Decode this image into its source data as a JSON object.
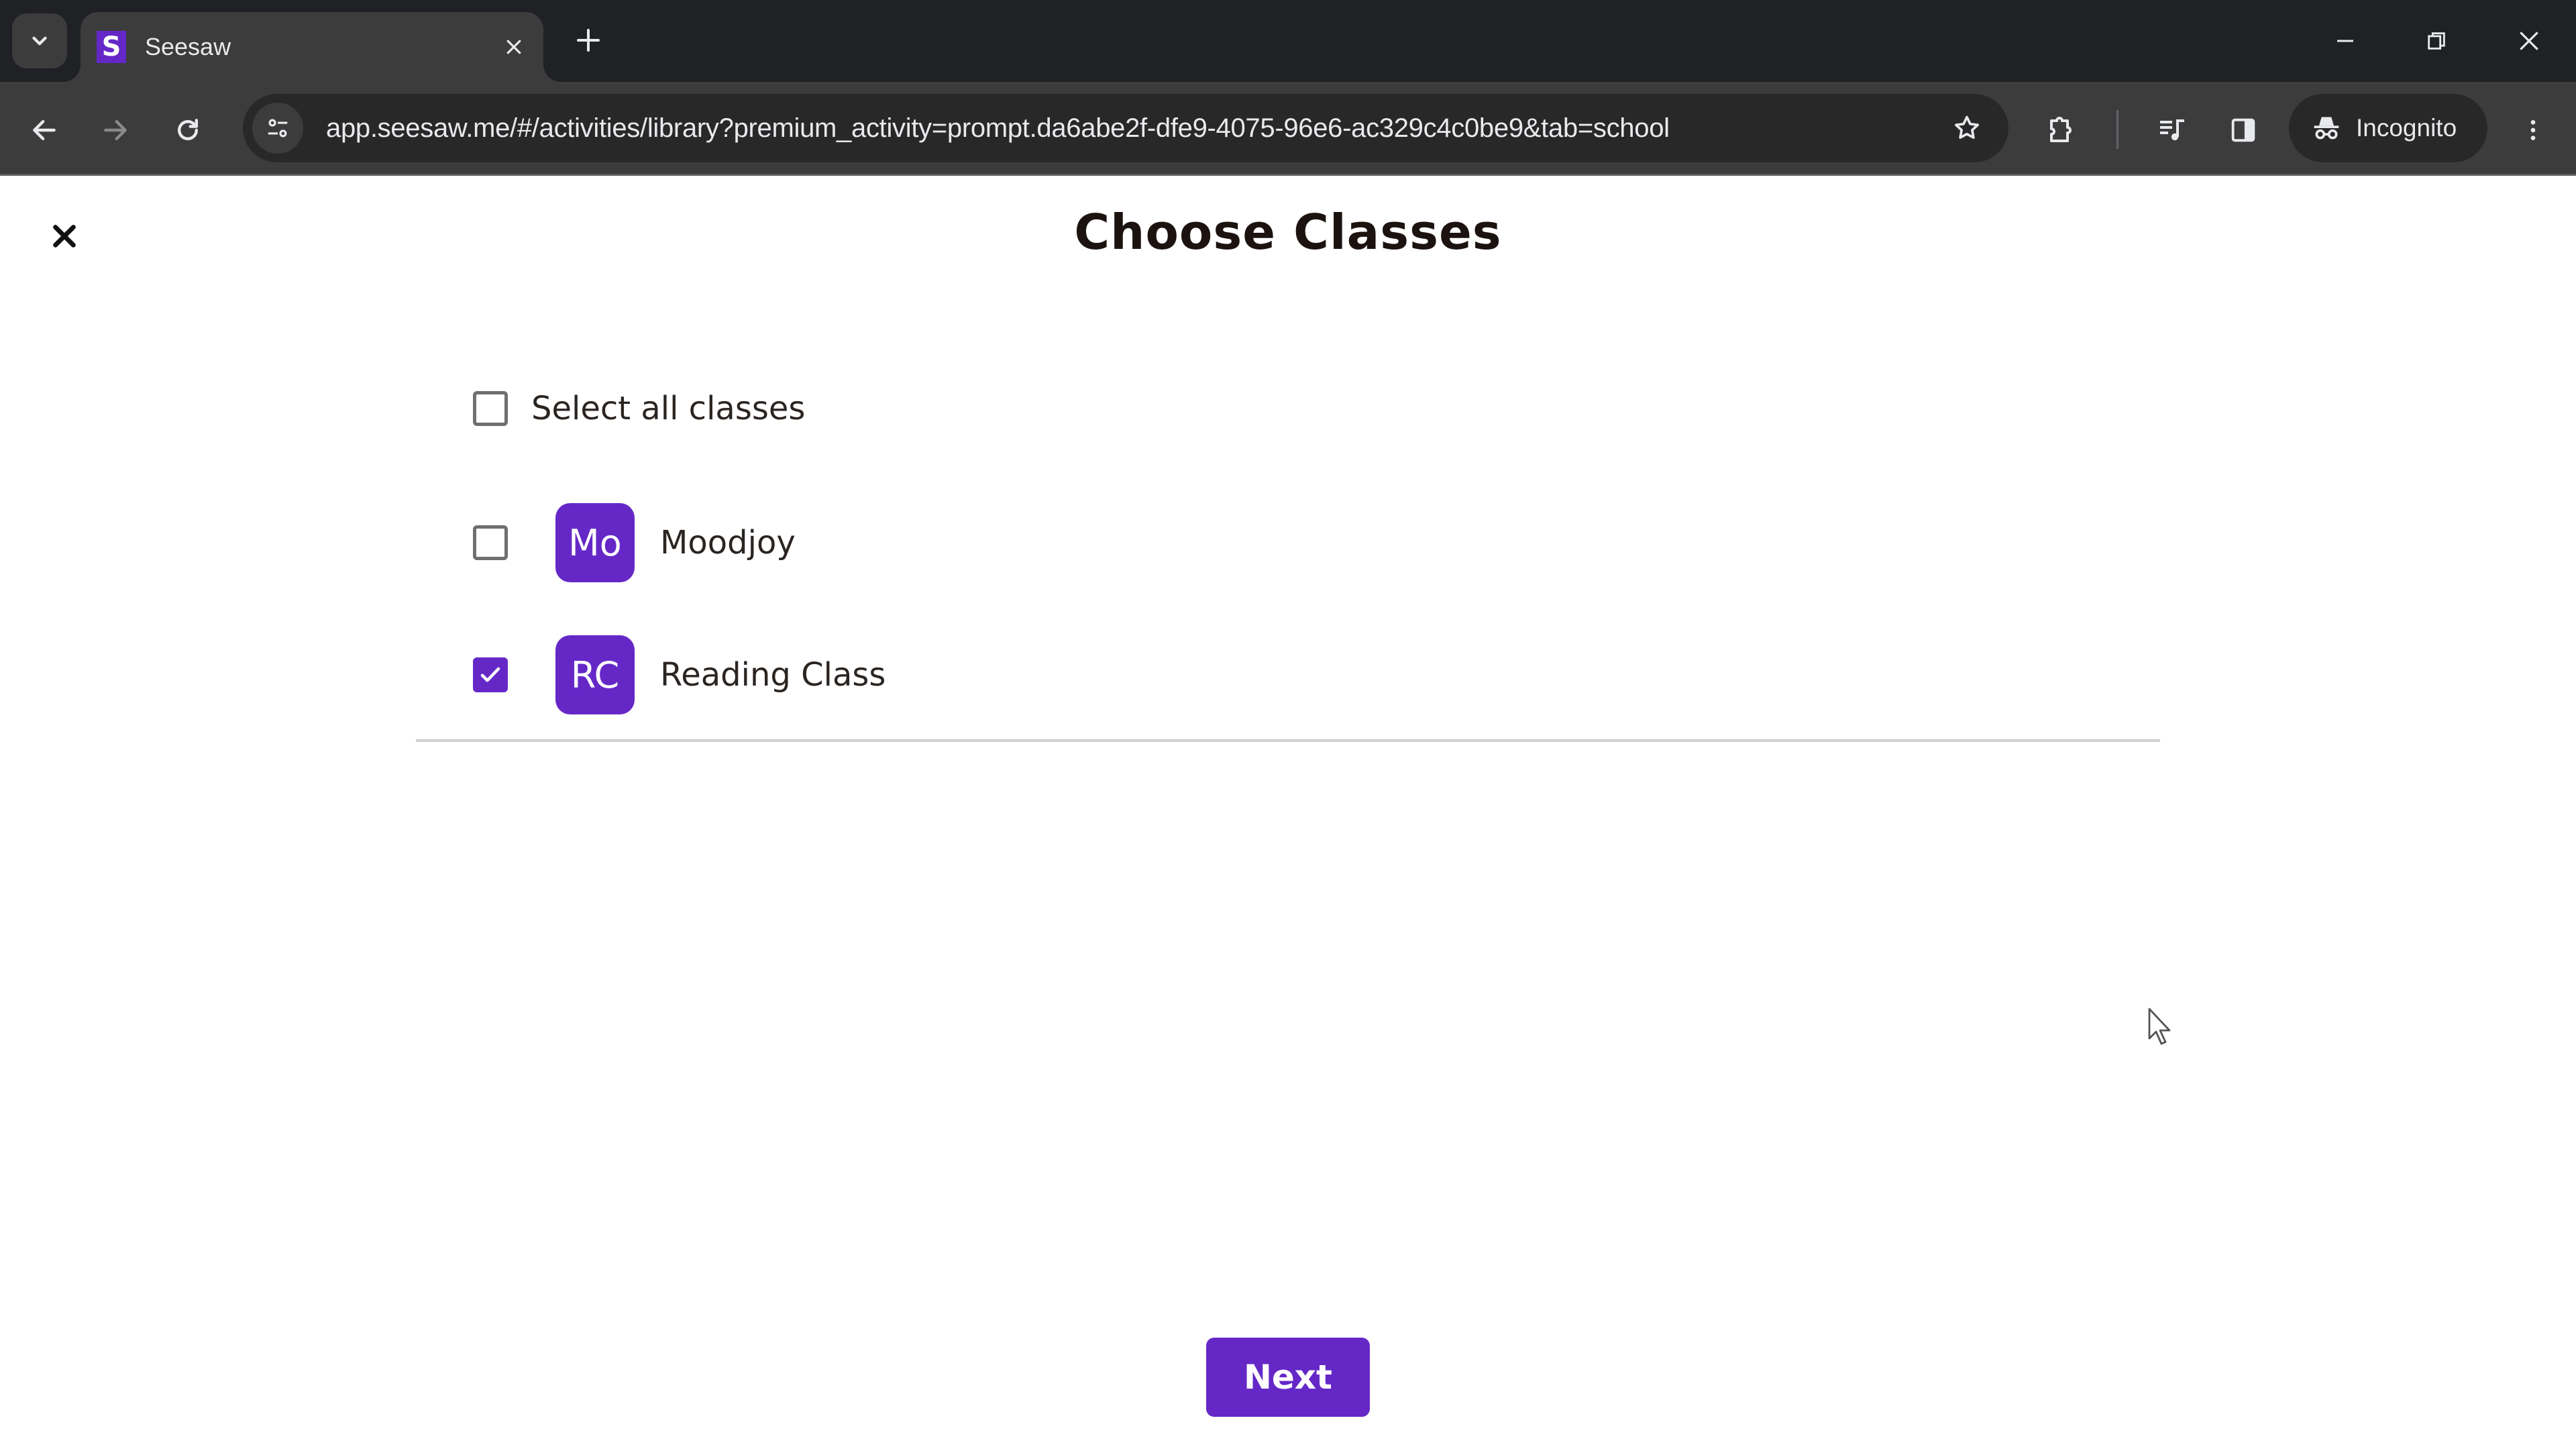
{
  "browser": {
    "tab": {
      "title": "Seesaw",
      "favicon_letter": "S"
    },
    "url": "app.seesaw.me/#/activities/library?premium_activity=prompt.da6abe2f-dfe9-4075-96e6-ac329c4c0be9&tab=school",
    "incognito_label": "Incognito"
  },
  "page": {
    "title": "Choose Classes",
    "select_all": {
      "label": "Select all classes",
      "checked": false
    },
    "classes": [
      {
        "initials": "Mo",
        "name": "Moodjoy",
        "checked": false
      },
      {
        "initials": "RC",
        "name": "Reading Class",
        "checked": true
      }
    ],
    "next_label": "Next"
  },
  "colors": {
    "accent": "#6528c7",
    "title_text": "#1c1310",
    "chrome_dark": "#202124",
    "chrome_toolbar": "#3c3c3c"
  }
}
